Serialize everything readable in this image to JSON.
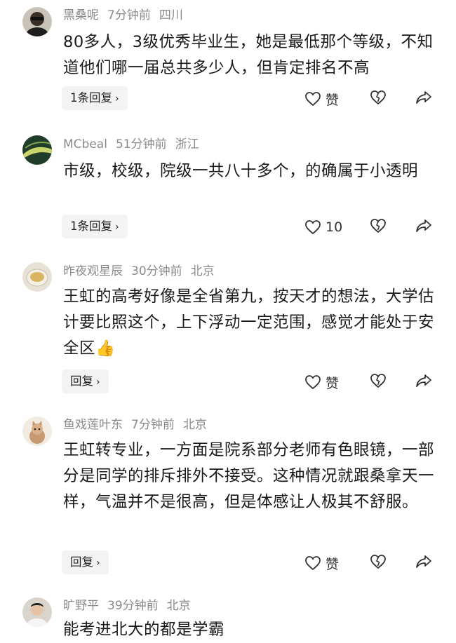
{
  "comments": [
    {
      "username": "黑桑呢",
      "time": "7分钟前",
      "location": "四川",
      "text": "80多人，3级优秀毕业生，她是最低那个等级，不知道他们哪一届总共多少人，但肯定排名不高",
      "reply_label": "1条回复",
      "like_label": "赞",
      "avatar": "person-dark-avatar"
    },
    {
      "username": "MCbeal",
      "time": "51分钟前",
      "location": "浙江",
      "text": "市级，校级，院级一共八十多个，的确属于小透明",
      "reply_label": "1条回复",
      "like_label": "10",
      "avatar": "leaf-avatar"
    },
    {
      "username": "昨夜观星辰",
      "time": "30分钟前",
      "location": "北京",
      "text": "王虹的高考好像是全省第九，按天才的想法，大学估计要比照这个，上下浮动一定范围，感觉才能处于安全区",
      "emoji": "👍",
      "reply_label": "回复",
      "like_label": "赞",
      "avatar": "tea-cup-avatar"
    },
    {
      "username": "鱼戏莲叶东",
      "time": "7分钟前",
      "location": "北京",
      "text": "王虹转专业，一方面是院系部分老师有色眼镜，一部分是同学的排斥排外不接受。这种情况就跟桑拿天一样，气温并不是很高，但是体感让人极其不舒服。",
      "reply_label": "回复",
      "like_label": "赞",
      "avatar": "cat-avatar"
    },
    {
      "username": "旷野平",
      "time": "39分钟前",
      "location": "北京",
      "text": "能考进北大的都是学霸",
      "avatar": "person-light-avatar"
    }
  ],
  "icons": {
    "like": "heart-icon",
    "dislike": "broken-heart-icon",
    "share": "share-icon",
    "reply_chevron": "›"
  },
  "colors": {
    "meta": "#8a8a8a",
    "text": "#1a1a1a",
    "reply_bg": "#f3f3f3"
  }
}
